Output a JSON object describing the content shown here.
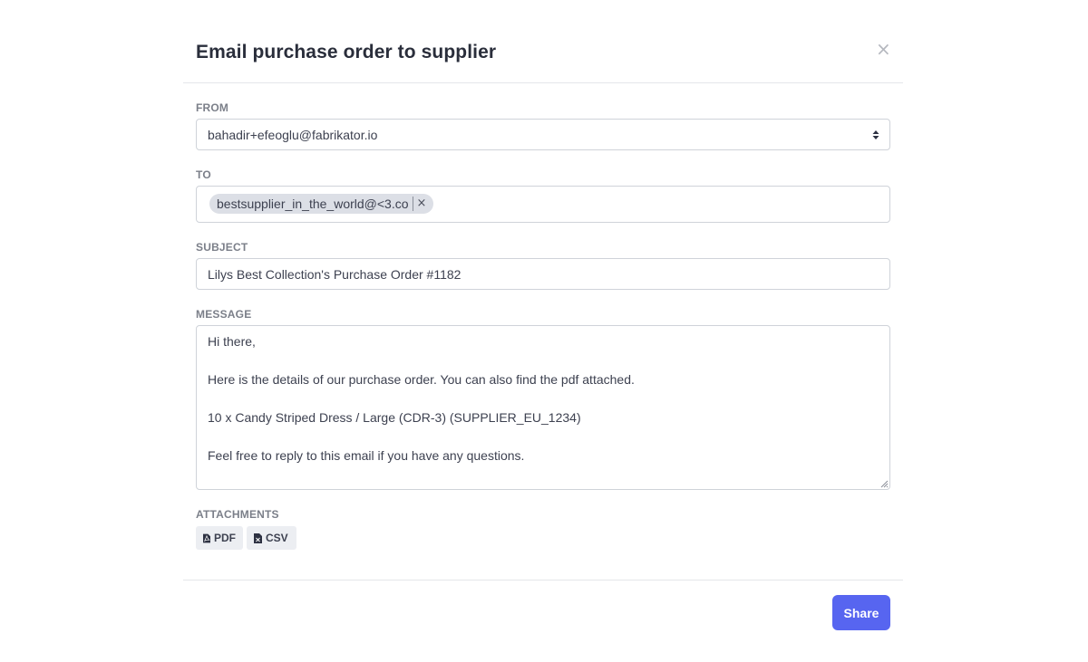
{
  "modal": {
    "title": "Email purchase order to supplier",
    "close_glyph": "×"
  },
  "from": {
    "label": "FROM",
    "value": "bahadir+efeoglu@fabrikator.io"
  },
  "to": {
    "label": "TO",
    "recipients": [
      {
        "email": "bestsupplier_in_the_world@<3.co",
        "remove_glyph": "×"
      }
    ]
  },
  "subject": {
    "label": "SUBJECT",
    "value": "Lilys Best Collection's Purchase Order #1182"
  },
  "message": {
    "label": "MESSAGE",
    "lines": [
      "Hi there,",
      "Here is the details of our purchase order. You can also find the pdf attached.",
      "10 x Candy Striped Dress / Large (CDR-3) (SUPPLIER_EU_1234)",
      "Feel free to reply to this email if you have any questions."
    ]
  },
  "attachments": {
    "label": "ATTACHMENTS",
    "items": [
      {
        "label": "PDF",
        "icon": "file-pdf-icon"
      },
      {
        "label": "CSV",
        "icon": "file-csv-icon"
      }
    ]
  },
  "footer": {
    "share_label": "Share"
  },
  "colors": {
    "primary": "#5765f0",
    "chip_bg": "#dcdfe6",
    "border": "#cfd3d9",
    "label": "#7b7f89"
  }
}
